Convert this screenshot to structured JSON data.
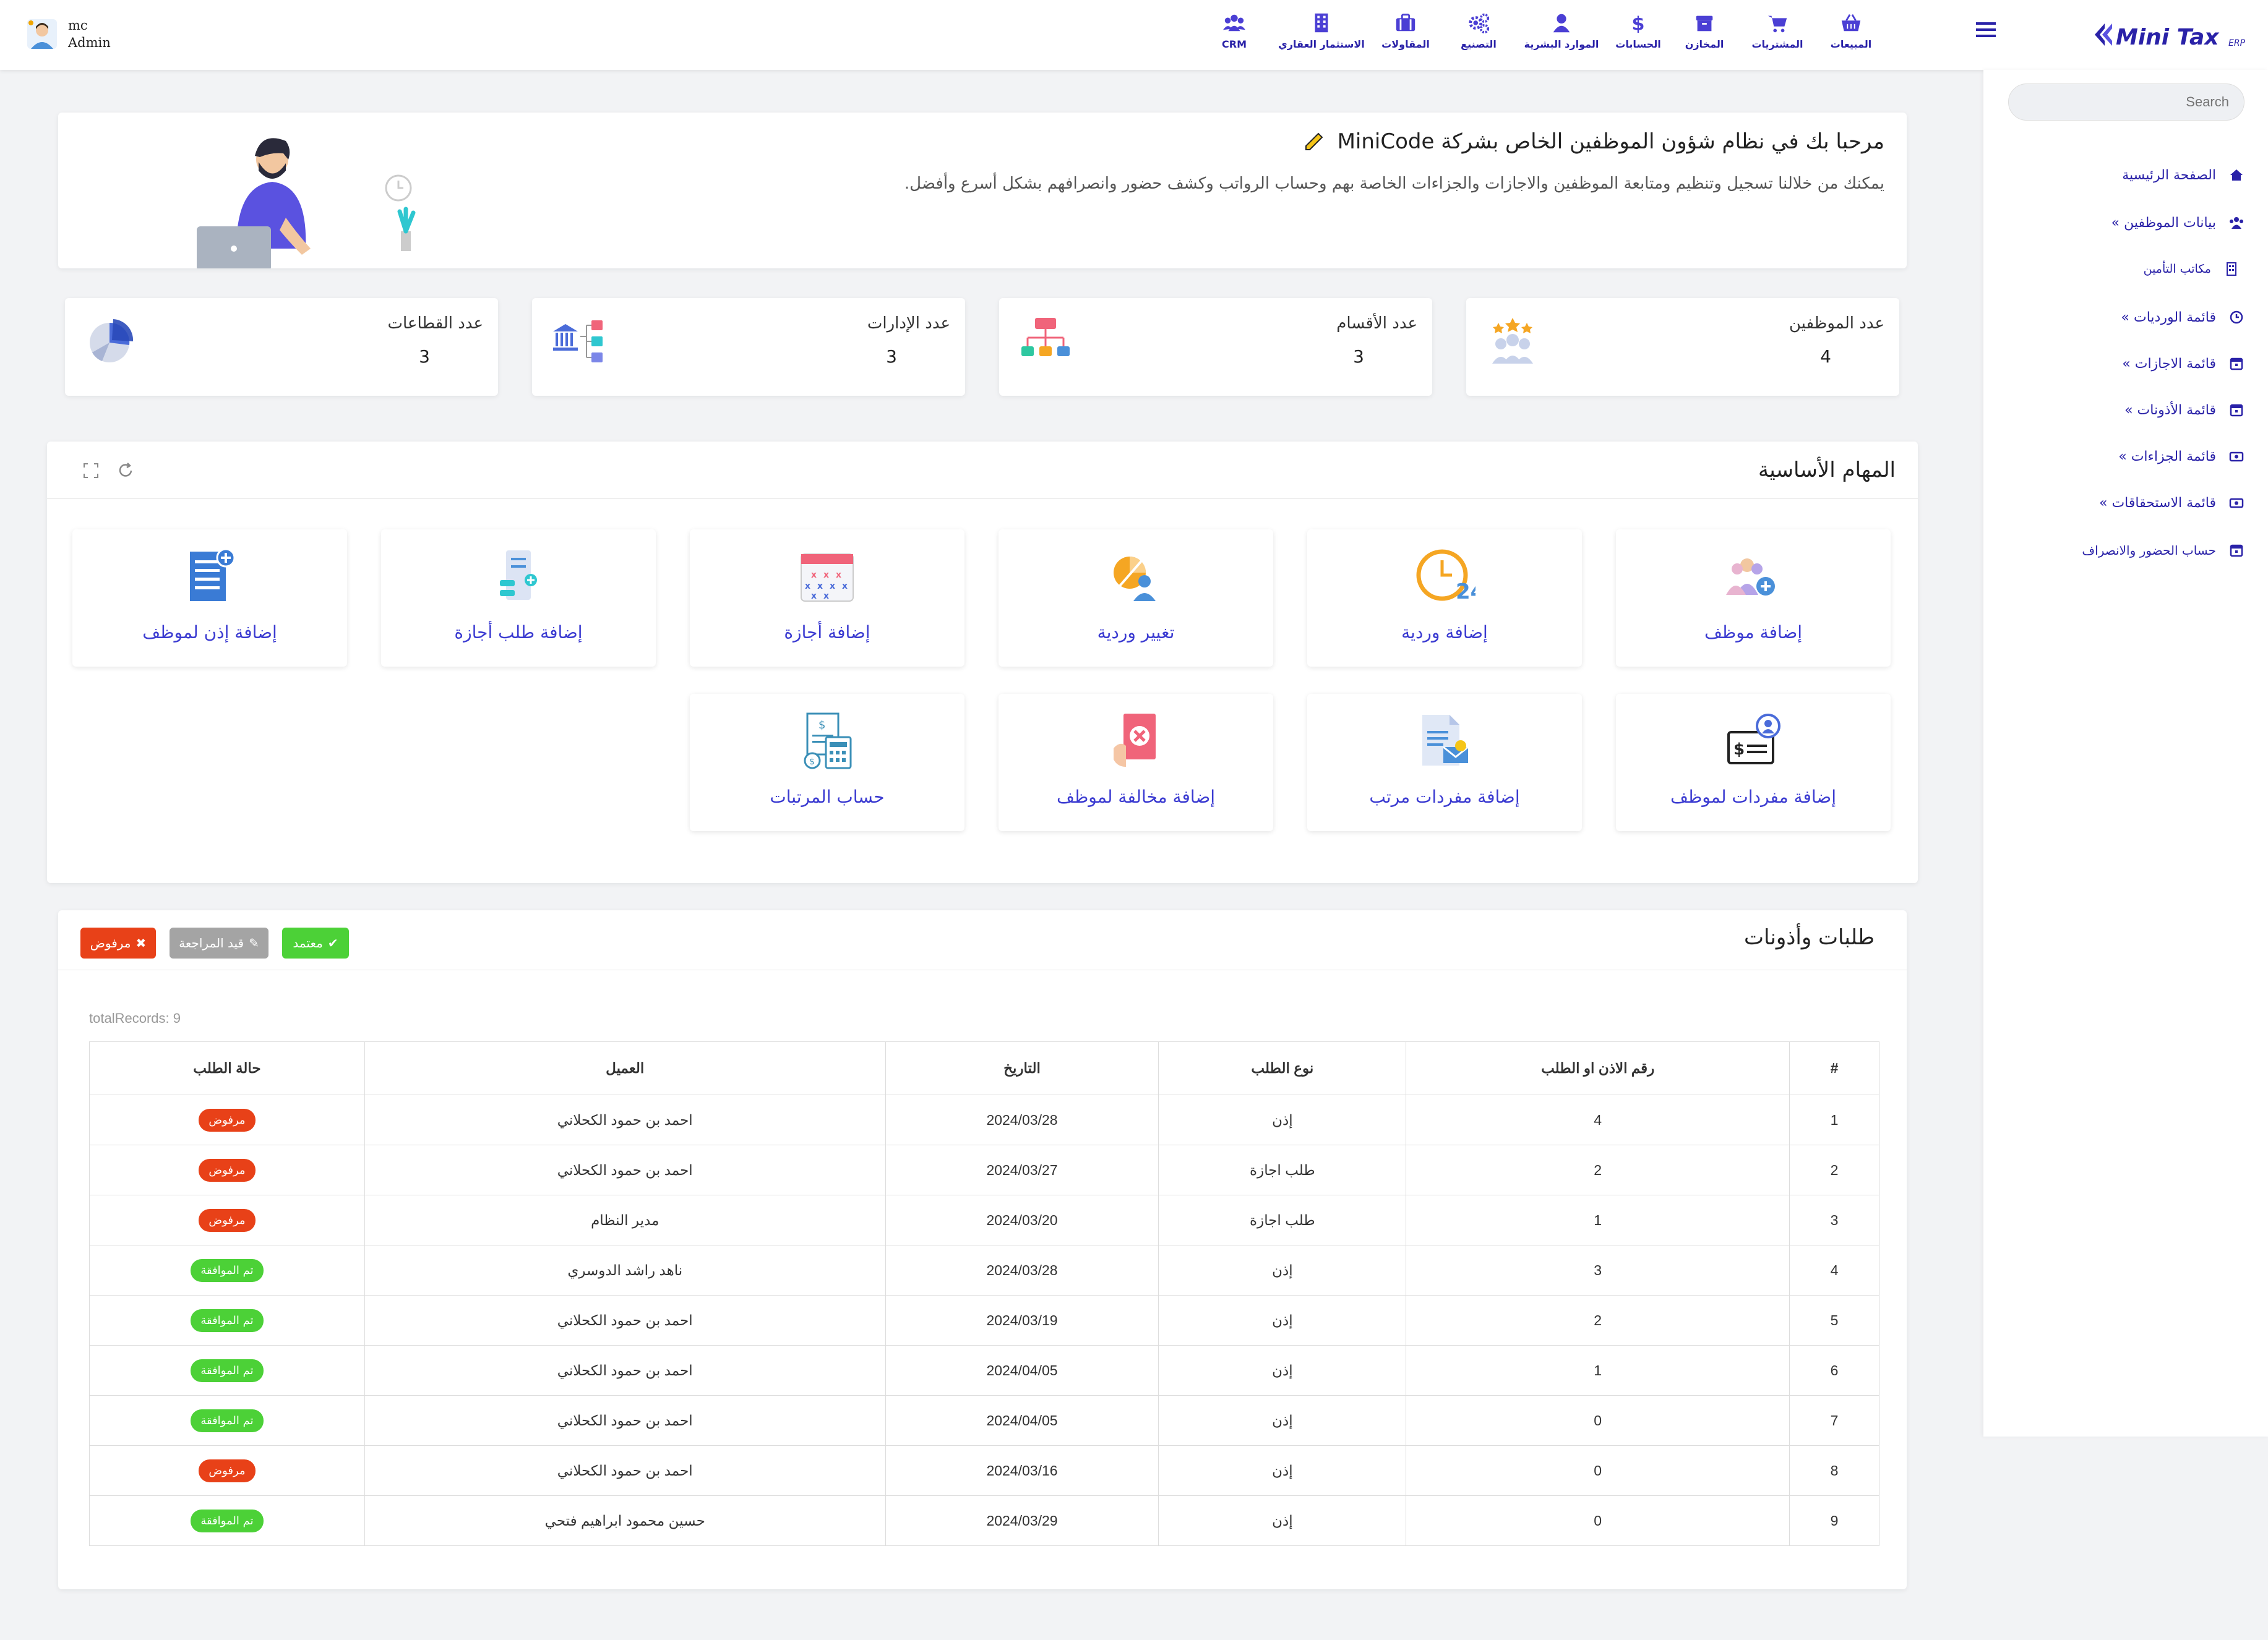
{
  "user": {
    "name": "mc",
    "role": "Admin"
  },
  "logo": {
    "text": "Mini Tax",
    "sub": "ERP"
  },
  "topnav": [
    {
      "label": "المبيعات",
      "icon": "basket-icon"
    },
    {
      "label": "المشتريات",
      "icon": "cart-icon"
    },
    {
      "label": "المخازن",
      "icon": "warehouse-icon"
    },
    {
      "label": "الحسابات",
      "icon": "dollar-icon"
    },
    {
      "label": "الموارد البشرية",
      "icon": "person-icon"
    },
    {
      "label": "التصنيع",
      "icon": "gears-icon"
    },
    {
      "label": "المقاولات",
      "icon": "briefcase-icon"
    },
    {
      "label": "الاستثمار العقاري",
      "icon": "building-icon"
    },
    {
      "label": "CRM",
      "icon": "users-icon"
    }
  ],
  "search": {
    "placeholder": "Search"
  },
  "sidebar": [
    {
      "label": "الصفحة الرئيسية",
      "icon": "home-icon"
    },
    {
      "label": "بيانات الموظفين »",
      "icon": "users-icon"
    },
    {
      "label": "مكاتب التأمين",
      "icon": "building-icon"
    },
    {
      "label": "قائمة الورديات »",
      "icon": "clock-icon"
    },
    {
      "label": "قائمة الاجازات »",
      "icon": "calendar-icon"
    },
    {
      "label": "قائمة الأذونات »",
      "icon": "calendar-icon"
    },
    {
      "label": "قائمة الجزاءات »",
      "icon": "money-icon"
    },
    {
      "label": "قائمة الاستحقاقات »",
      "icon": "money-icon"
    },
    {
      "label": "حساب الحضور والانصراف",
      "icon": "calendar-icon"
    }
  ],
  "welcome": {
    "title": "مرحبا بك في نظام شؤون الموظفين الخاص بشركة MiniCode",
    "subtitle": "يمكنك من خلالنا تسجيل وتنظيم ومتابعة الموظفين والاجازات والجزاءات الخاصة بهم وحساب الرواتب وكشف حضور وانصرافهم بشكل أسرع وأفضل."
  },
  "stats": [
    {
      "label": "عدد الموظفين",
      "value": "4"
    },
    {
      "label": "عدد الأقسام",
      "value": "3"
    },
    {
      "label": "عدد الإدارات",
      "value": "3"
    },
    {
      "label": "عدد القطاعات",
      "value": "3"
    }
  ],
  "tasks": {
    "title": "المهام الأساسية",
    "items": [
      {
        "label": "إضافة موظف",
        "icon": "add-user-icon"
      },
      {
        "label": "إضافة وردية",
        "icon": "clock-24-icon"
      },
      {
        "label": "تغيير وردية",
        "icon": "shift-change-icon"
      },
      {
        "label": "إضافة أجازة",
        "icon": "calendar-icon"
      },
      {
        "label": "إضافة طلب أجازة",
        "icon": "request-icon"
      },
      {
        "label": "إضافة إذن لموظف",
        "icon": "permission-icon"
      },
      {
        "label": "إضافة مفردات لموظف",
        "icon": "employee-money-icon"
      },
      {
        "label": "إضافة مفردات مرتب",
        "icon": "salary-doc-icon"
      },
      {
        "label": "إضافة مخالفة لموظف",
        "icon": "violation-icon"
      },
      {
        "label": "حساب المرتبات",
        "icon": "payroll-calc-icon"
      }
    ]
  },
  "requests": {
    "title": "طلبات وأذونات",
    "badges": {
      "approved": "معتمد",
      "review": "قيد المراجعة",
      "rejected": "مرفوض"
    },
    "total": "totalRecords: 9",
    "columns": [
      "#",
      "رقم الاذن او الطلب",
      "نوع الطلب",
      "التاريخ",
      "العميل",
      "حالة الطلب"
    ],
    "rows": [
      [
        "1",
        "4",
        "إذن",
        "2024/03/28",
        "احمد بن حمود الكحلاني",
        "مرفوض"
      ],
      [
        "2",
        "2",
        "طلب اجازة",
        "2024/03/27",
        "احمد بن حمود الكحلاني",
        "مرفوض"
      ],
      [
        "3",
        "1",
        "طلب اجازة",
        "2024/03/20",
        "مدير النظام",
        "مرفوض"
      ],
      [
        "4",
        "3",
        "إذن",
        "2024/03/28",
        "ناهد راشد الدوسري",
        "تم الموافقة"
      ],
      [
        "5",
        "2",
        "إذن",
        "2024/03/19",
        "احمد بن حمود الكحلاني",
        "تم الموافقة"
      ],
      [
        "6",
        "1",
        "إذن",
        "2024/04/05",
        "احمد بن حمود الكحلاني",
        "تم الموافقة"
      ],
      [
        "7",
        "0",
        "إذن",
        "2024/04/05",
        "احمد بن حمود الكحلاني",
        "تم الموافقة"
      ],
      [
        "8",
        "0",
        "إذن",
        "2024/03/16",
        "احمد بن حمود الكحلاني",
        "مرفوض"
      ],
      [
        "9",
        "0",
        "إذن",
        "2024/03/29",
        "حسين محمود ابراهيم فتحي",
        "تم الموافقة"
      ]
    ]
  },
  "colors": {
    "accent": "#3b3bd1",
    "approved": "#4cd137",
    "rejected": "#e84118",
    "review": "#a4a4a4"
  }
}
